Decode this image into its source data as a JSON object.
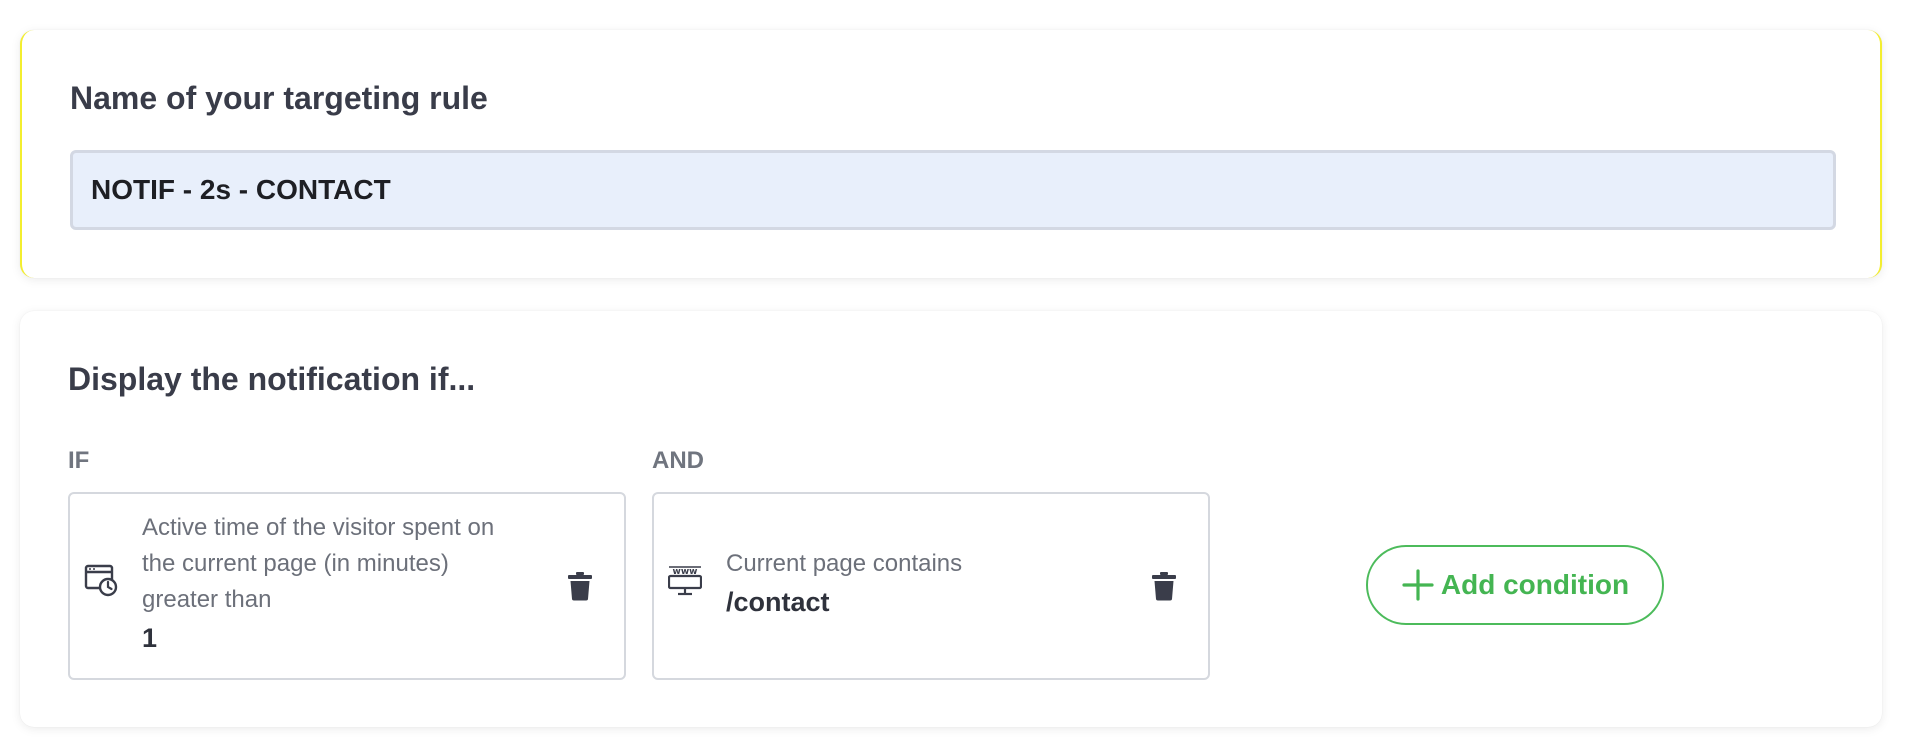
{
  "rule_name": {
    "title": "Name of your targeting rule",
    "value": "NOTIF - 2s - CONTACT"
  },
  "display": {
    "title": "Display the notification if...",
    "if_label": "IF",
    "and_label": "AND",
    "conditions": [
      {
        "icon": "browser-clock-icon",
        "text": "Active time of the visitor spent on the current page (in minutes) greater than",
        "value": "1"
      },
      {
        "icon": "www-monitor-icon",
        "text": "Current page contains",
        "value": "/contact"
      }
    ],
    "add_condition_label": "Add condition"
  },
  "colors": {
    "accent_green": "#44b552",
    "highlight_yellow": "#f3ee2f",
    "input_bg": "#e8effb"
  }
}
